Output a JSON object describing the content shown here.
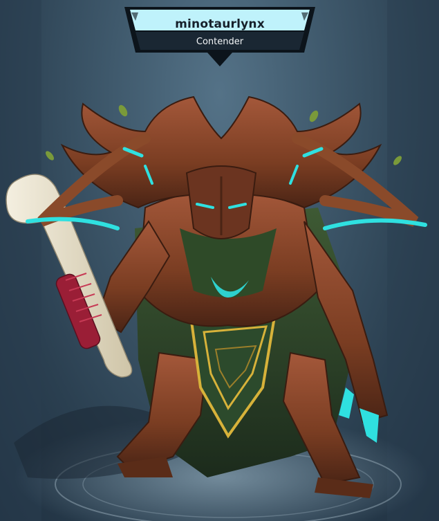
{
  "nameplate": {
    "player_name": "minotaurlynx",
    "rank_title": "Contender"
  },
  "colors": {
    "banner_top": "#bff2fb",
    "banner_bottom": "#1a2733",
    "banner_frame": "#0c141b",
    "skin_wood": "#8a4a2a",
    "glow_teal": "#2fe0e0",
    "leaf_green": "#3d5a2e",
    "gold_trim": "#d7b23a",
    "bone": "#e8e1cc",
    "grip_red": "#9a1e36"
  },
  "scene": {
    "character_icon": "treant-warrior-icon",
    "weapon_icon": "bone-club-icon"
  }
}
